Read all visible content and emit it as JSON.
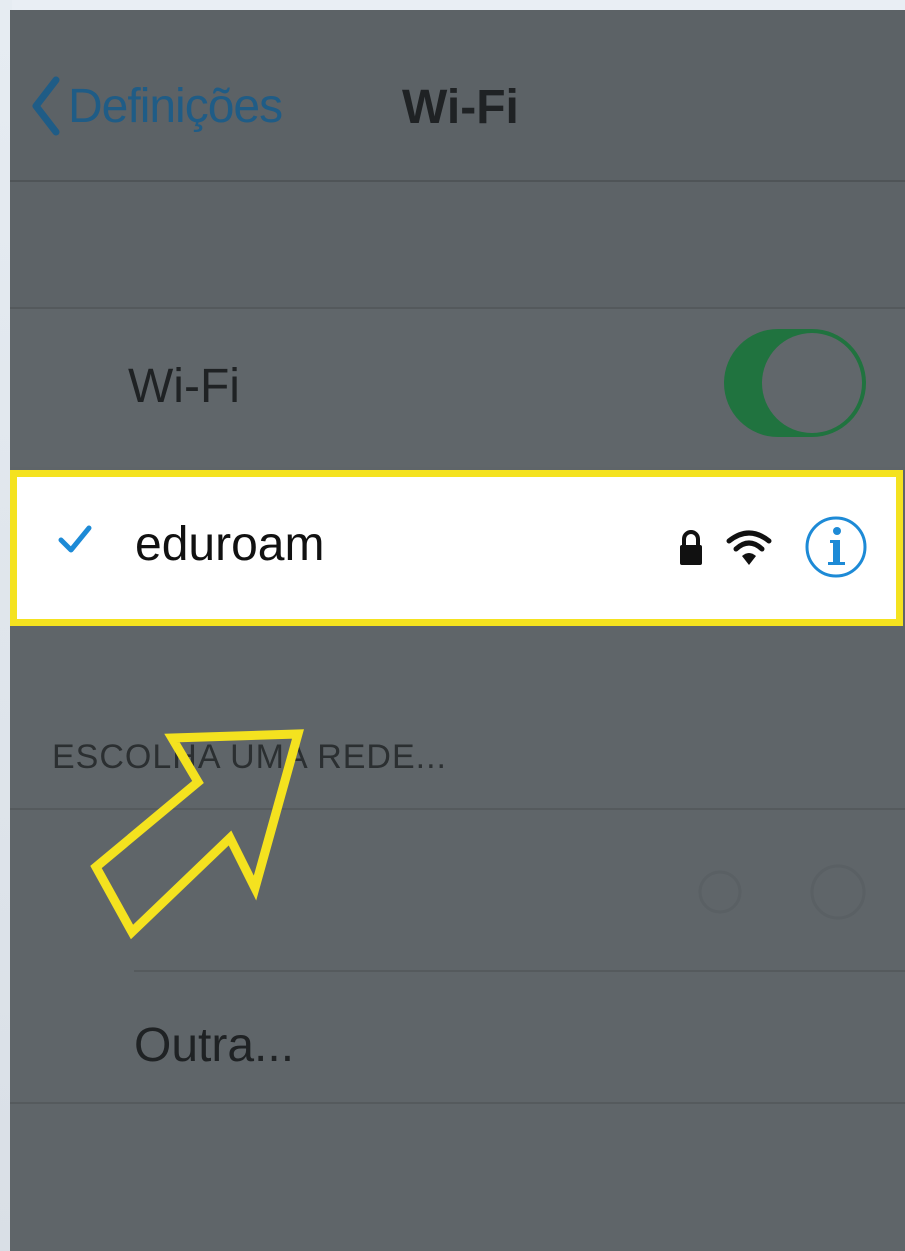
{
  "nav": {
    "back_label": "Definições",
    "title": "Wi-Fi"
  },
  "wifi_row": {
    "label": "Wi-Fi",
    "toggle_on": true
  },
  "connected_network": {
    "name": "eduroam",
    "icons": [
      "checkmark-icon",
      "lock-icon",
      "wifi-signal-icon",
      "info-icon"
    ]
  },
  "section_header": "ESCOLHA UMA REDE...",
  "other_row": {
    "label": "Outra..."
  },
  "colors": {
    "toggle_green": "#20733f",
    "highlight_yellow": "#f4e21f",
    "ios_blue": "#1d8ad6",
    "overlay_gray": "#5f6569"
  }
}
